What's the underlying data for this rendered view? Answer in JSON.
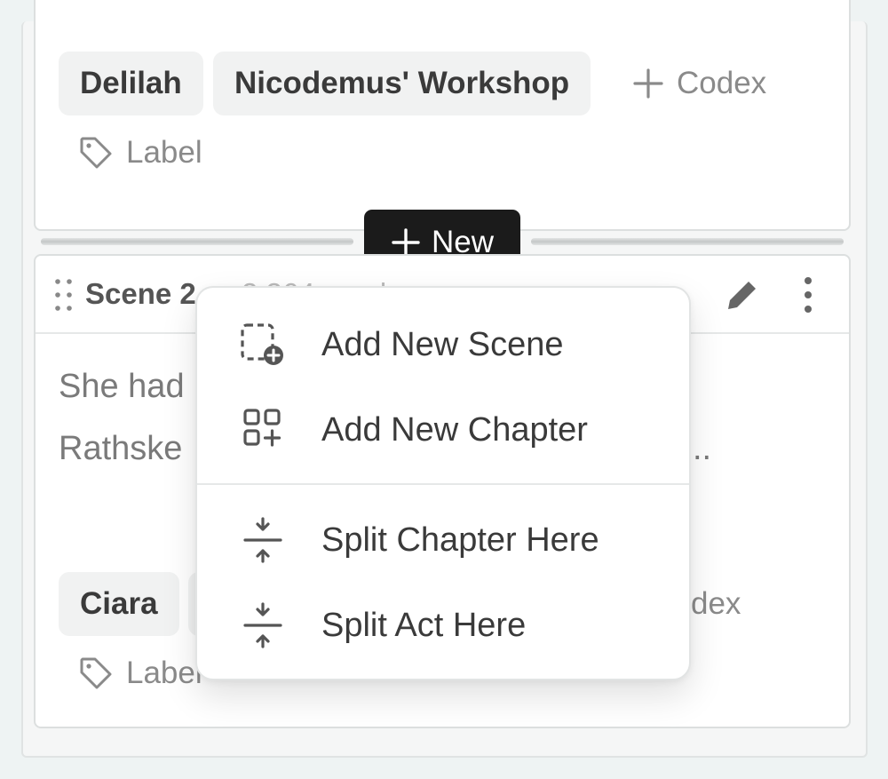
{
  "top_card": {
    "tags": [
      "Delilah",
      "Nicodemus' Workshop"
    ],
    "add_codex_label": "Codex",
    "label_button": "Label"
  },
  "new_button": {
    "label": "New"
  },
  "scene": {
    "title": "Scene 2",
    "word_count": "2,364 words",
    "text_line1": "She had",
    "text_line2": "Rathske",
    "text_tail": "..",
    "tags": [
      "Ciara"
    ],
    "add_codex_partial": "dex",
    "label_button": "Label"
  },
  "menu": {
    "items": [
      {
        "label": "Add New Scene",
        "icon": "add-scene-icon"
      },
      {
        "label": "Add New Chapter",
        "icon": "add-chapter-icon"
      },
      {
        "label": "Split Chapter Here",
        "icon": "split-icon"
      },
      {
        "label": "Split Act Here",
        "icon": "split-icon"
      }
    ]
  }
}
